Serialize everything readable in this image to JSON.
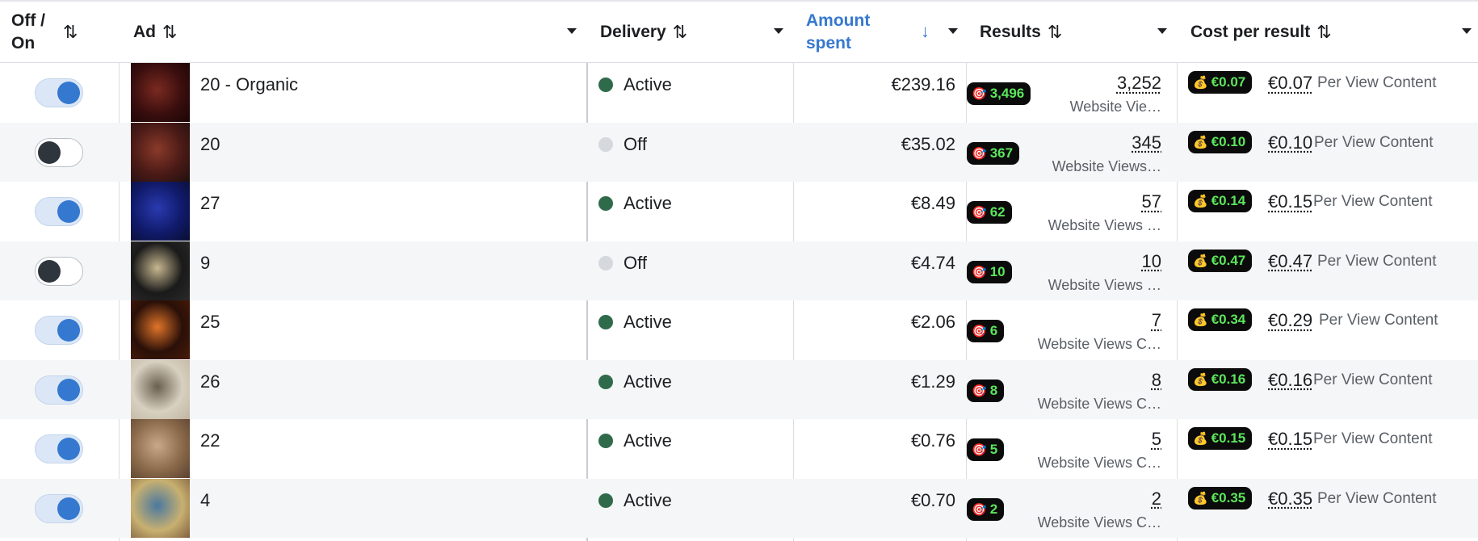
{
  "colors": {
    "accent_blue": "#3578cf",
    "active_green": "#2f6b4b",
    "off_gray": "#d5d8dc",
    "badge_bg": "#0b0b0b",
    "badge_text": "#5ce65c",
    "amount_header": "#3578cf"
  },
  "headers": {
    "toggle_line1": "Off /",
    "toggle_line2": "On",
    "ad": "Ad",
    "delivery": "Delivery",
    "amount_line1": "Amount",
    "amount_line2": "spent",
    "results": "Results",
    "cost": "Cost per result",
    "sort_glyph": "⇅",
    "sort_desc_glyph": "↓"
  },
  "icons": {
    "target": "target-icon",
    "money_bag": "money-bag-icon",
    "sort": "sort-icon",
    "dropdown": "dropdown-icon"
  },
  "rows": [
    {
      "on": true,
      "thumb": [
        "#3a0e0e",
        "#7a2a20",
        "#1a0505"
      ],
      "name": "20 - Organic",
      "status": "active",
      "delivery": "Active",
      "amount": "€239.16",
      "badge": "3,496",
      "results": "3,252",
      "result_type": "Website Vie…",
      "cost_badge": "€0.07",
      "cost": "€0.07",
      "cost_type": "Per View Content"
    },
    {
      "on": false,
      "thumb": [
        "#4a1a16",
        "#8a3a2a",
        "#201010"
      ],
      "name": "20",
      "status": "off",
      "delivery": "Off",
      "amount": "€35.02",
      "badge": "367",
      "results": "345",
      "result_type": "Website Views…",
      "cost_badge": "€0.10",
      "cost": "€0.10",
      "cost_type": "Per View Content"
    },
    {
      "on": true,
      "thumb": [
        "#101a6a",
        "#2a3ab0",
        "#0a0e30"
      ],
      "name": "27",
      "status": "active",
      "delivery": "Active",
      "amount": "€8.49",
      "badge": "62",
      "results": "57",
      "result_type": "Website Views …",
      "cost_badge": "€0.14",
      "cost": "€0.15",
      "cost_type": "Per View Content"
    },
    {
      "on": false,
      "thumb": [
        "#1a1a1a",
        "#c8b890",
        "#2a2a2a"
      ],
      "name": "9",
      "status": "off",
      "delivery": "Off",
      "amount": "€4.74",
      "badge": "10",
      "results": "10",
      "result_type": "Website Views …",
      "cost_badge": "€0.47",
      "cost": "€0.47",
      "cost_type": "Per View Content"
    },
    {
      "on": true,
      "thumb": [
        "#2a1008",
        "#e0742a",
        "#4a1a08"
      ],
      "name": "25",
      "status": "active",
      "delivery": "Active",
      "amount": "€2.06",
      "badge": "6",
      "results": "7",
      "result_type": "Website Views C…",
      "cost_badge": "€0.34",
      "cost": "€0.29",
      "cost_type": "Per View Content"
    },
    {
      "on": true,
      "thumb": [
        "#d8d0c0",
        "#6a6050",
        "#bfb5a0"
      ],
      "name": "26",
      "status": "active",
      "delivery": "Active",
      "amount": "€1.29",
      "badge": "8",
      "results": "8",
      "result_type": "Website Views C…",
      "cost_badge": "€0.16",
      "cost": "€0.16",
      "cost_type": "Per View Content"
    },
    {
      "on": true,
      "thumb": [
        "#8a6a4a",
        "#c8a888",
        "#5a4030"
      ],
      "name": "22",
      "status": "active",
      "delivery": "Active",
      "amount": "€0.76",
      "badge": "5",
      "results": "5",
      "result_type": "Website Views C…",
      "cost_badge": "€0.15",
      "cost": "€0.15",
      "cost_type": "Per View Content"
    },
    {
      "on": true,
      "thumb": [
        "#c8b070",
        "#4a78a0",
        "#806040"
      ],
      "name": "4",
      "status": "active",
      "delivery": "Active",
      "amount": "€0.70",
      "badge": "2",
      "results": "2",
      "result_type": "Website Views C…",
      "cost_badge": "€0.35",
      "cost": "€0.35",
      "cost_type": "Per View Content"
    }
  ]
}
